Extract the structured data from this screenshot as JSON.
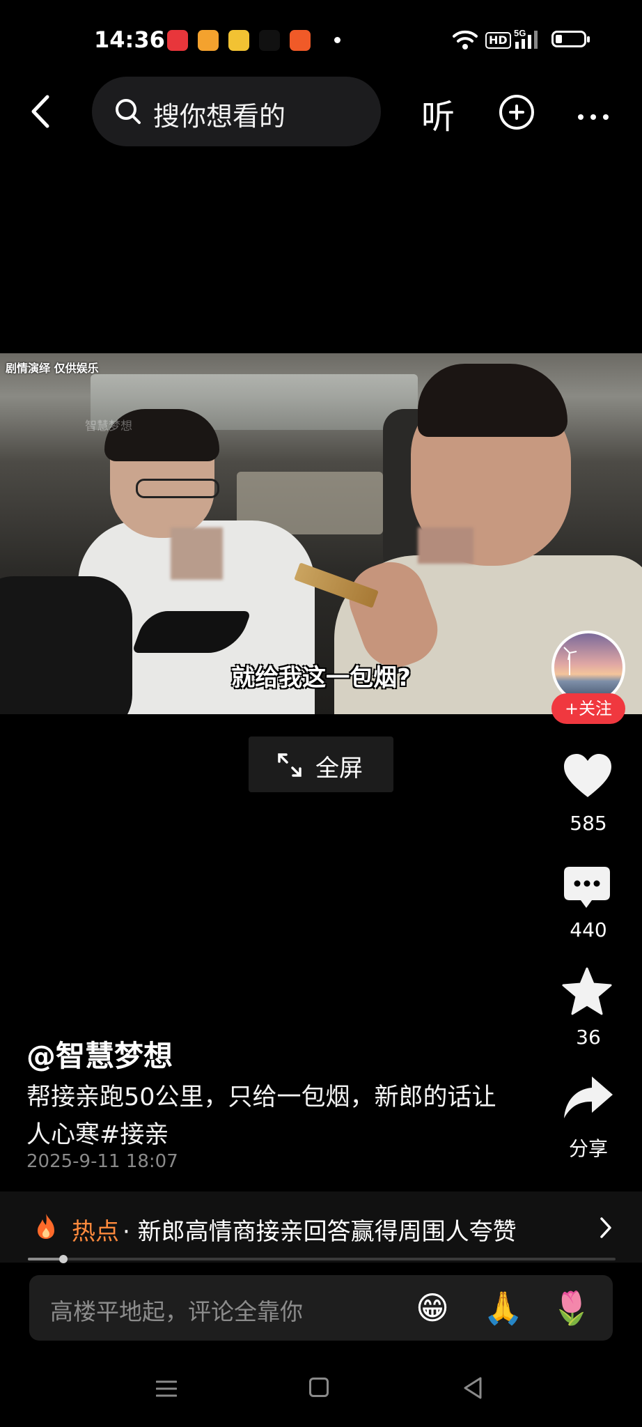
{
  "status_bar": {
    "time": "14:36",
    "app_icons": [
      {
        "name": "toutiao-app-icon",
        "color": "#e8363b"
      },
      {
        "name": "bilibili-app-icon",
        "color": "#f4a22e"
      },
      {
        "name": "heart-app-icon",
        "color": "#f2c233"
      },
      {
        "name": "tiktok-app-icon",
        "color": "#111111"
      },
      {
        "name": "video-play-app-icon",
        "color": "#f05a28"
      }
    ],
    "network_badge": "HD",
    "signal_label": "5G"
  },
  "top_nav": {
    "search_placeholder": "搜你想看的",
    "listen_label": "听"
  },
  "video": {
    "corner_text": "剧情演绎  仅供娱乐",
    "watermark": "智慧梦想",
    "subtitle": "就给我这一包烟?"
  },
  "author": {
    "follow_label": "+关注",
    "name": "@智慧梦想"
  },
  "fullscreen_label": "全屏",
  "actions": {
    "likes": "585",
    "comments": "440",
    "favorites": "36",
    "share_label": "分享"
  },
  "caption": {
    "text": "帮接亲跑50公里，只给一包烟，新郎的话让人心寒#接亲",
    "date": "2025-9-11 18:07"
  },
  "hot": {
    "label": "热点",
    "text": "· 新郎高情商接亲回答赢得周围人夸赞"
  },
  "progress": 0.06,
  "comment_bar": {
    "placeholder": "高楼平地起，评论全靠你",
    "emojis": [
      "😁",
      "🙏",
      "🌷"
    ]
  },
  "colors": {
    "accent_red": "#f0383f",
    "hot_orange": "#ff8a3d"
  }
}
